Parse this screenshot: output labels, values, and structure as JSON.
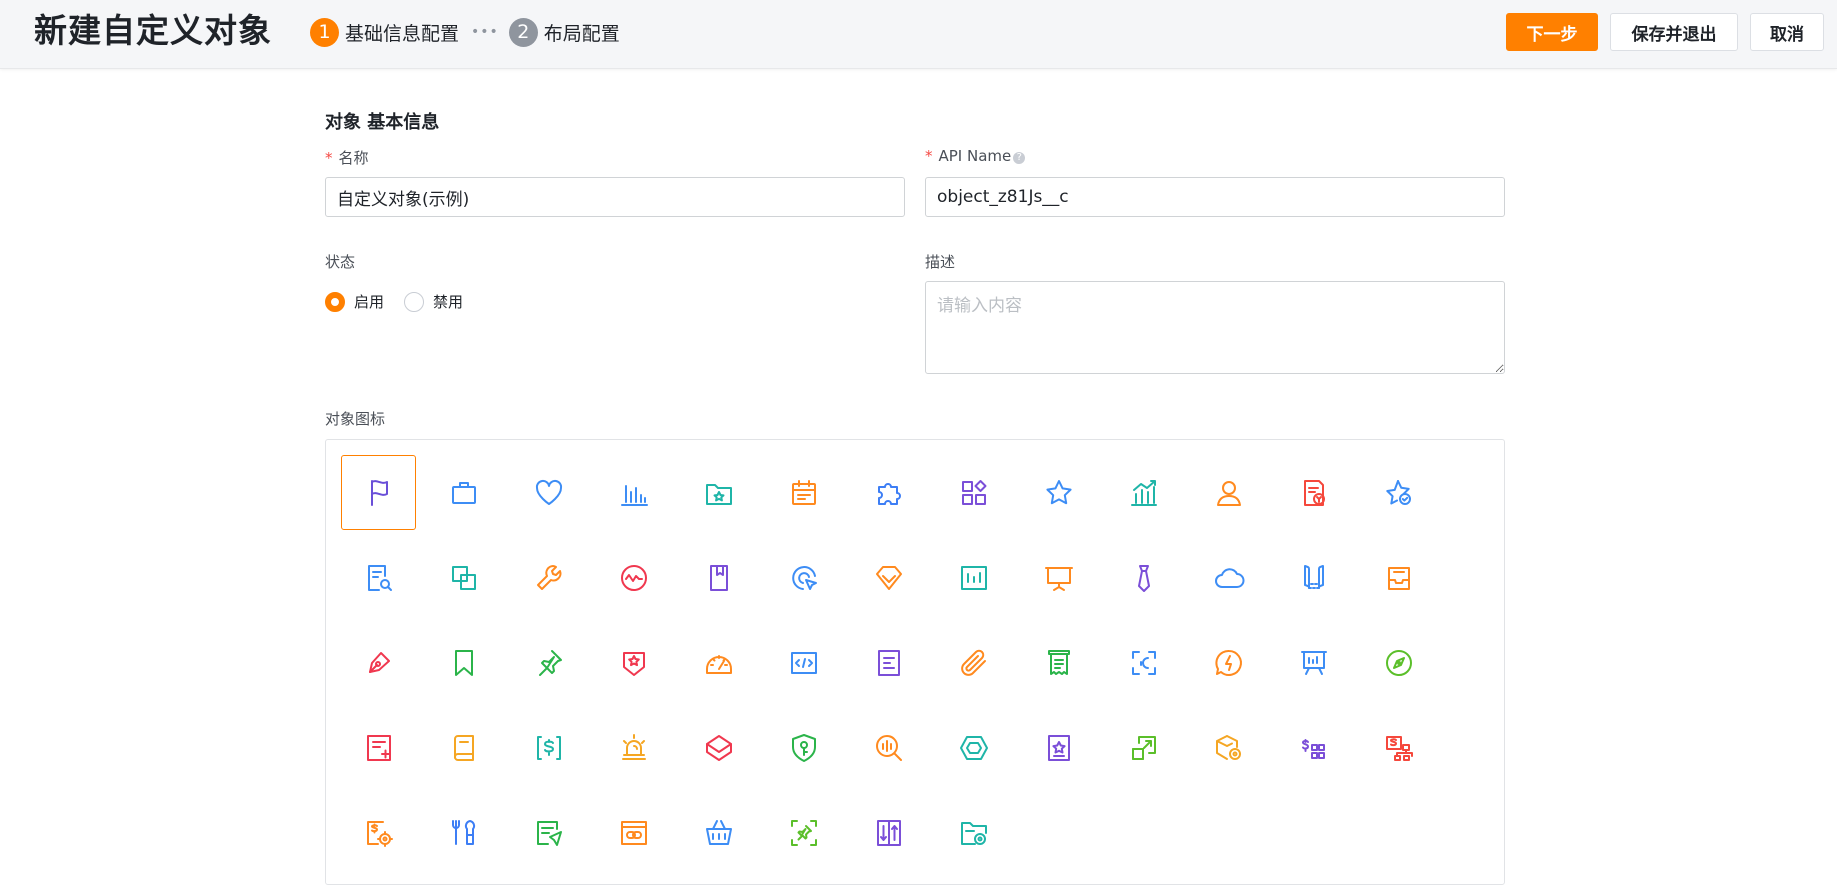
{
  "header": {
    "title": "新建自定义对象",
    "steps": [
      {
        "num": "1",
        "label": "基础信息配置"
      },
      {
        "num": "2",
        "label": "布局配置"
      }
    ],
    "step_separator": "•••",
    "buttons": {
      "next": "下一步",
      "save_exit": "保存并退出",
      "cancel": "取消"
    }
  },
  "form": {
    "section_title": "对象 基本信息",
    "name": {
      "label": "名称",
      "required_mark": "*",
      "value": "自定义对象(示例)"
    },
    "api_name": {
      "label": "API Name",
      "required_mark": "*",
      "help": "?",
      "value": "object_z81Js__c"
    },
    "status": {
      "label": "状态",
      "options": [
        {
          "label": "启用",
          "checked": true
        },
        {
          "label": "禁用",
          "checked": false
        }
      ]
    },
    "description": {
      "label": "描述",
      "placeholder": "请输入内容"
    },
    "icon_label": "对象图标"
  },
  "icons": [
    {
      "name": "flag",
      "color": "#6a4fd8",
      "selected": true
    },
    {
      "name": "briefcase",
      "color": "#3d8df5"
    },
    {
      "name": "heart",
      "color": "#3d8df5"
    },
    {
      "name": "bar-chart",
      "color": "#3d8df5"
    },
    {
      "name": "folder-star",
      "color": "#1fb5a8"
    },
    {
      "name": "calendar",
      "color": "#ff8a1f"
    },
    {
      "name": "puzzle",
      "color": "#3d7ef5"
    },
    {
      "name": "apps",
      "color": "#7b4fd8"
    },
    {
      "name": "star",
      "color": "#3d8df5"
    },
    {
      "name": "trend-chart",
      "color": "#1fb5a8"
    },
    {
      "name": "user",
      "color": "#ff8a1f"
    },
    {
      "name": "invoice",
      "color": "#f5483c"
    },
    {
      "name": "star-check",
      "color": "#3d8df5"
    },
    {
      "name": "doc-search",
      "color": "#3d8df5"
    },
    {
      "name": "copy",
      "color": "#1fb5a8"
    },
    {
      "name": "wrench",
      "color": "#ff8a1f"
    },
    {
      "name": "activity",
      "color": "#f0384f"
    },
    {
      "name": "bookmark-book",
      "color": "#7b4fd8"
    },
    {
      "name": "cursor-target",
      "color": "#3d8df5"
    },
    {
      "name": "diamond",
      "color": "#ff8a1f"
    },
    {
      "name": "chart-window",
      "color": "#1fb5a8"
    },
    {
      "name": "presentation",
      "color": "#ff8a1f"
    },
    {
      "name": "tie",
      "color": "#7b4fd8"
    },
    {
      "name": "cloud",
      "color": "#3d8df5"
    },
    {
      "name": "map-book",
      "color": "#3d8df5"
    },
    {
      "name": "inbox",
      "color": "#ff8a1f"
    },
    {
      "name": "pen",
      "color": "#f0384f"
    },
    {
      "name": "bookmark",
      "color": "#2bb44a"
    },
    {
      "name": "pin",
      "color": "#2bb44a"
    },
    {
      "name": "badge-star",
      "color": "#f0384f"
    },
    {
      "name": "gauge",
      "color": "#ff8a1f"
    },
    {
      "name": "code",
      "color": "#3d8df5"
    },
    {
      "name": "document",
      "color": "#7b4fd8"
    },
    {
      "name": "paperclip",
      "color": "#ff8a1f"
    },
    {
      "name": "receipt",
      "color": "#2bb44a"
    },
    {
      "name": "face-scan",
      "color": "#3d8df5"
    },
    {
      "name": "chat-flash",
      "color": "#ff8a1f"
    },
    {
      "name": "board",
      "color": "#3d8df5"
    },
    {
      "name": "compass",
      "color": "#5bbf2a"
    },
    {
      "name": "doc-plus",
      "color": "#f0384f"
    },
    {
      "name": "book",
      "color": "#f5a623"
    },
    {
      "name": "money-frame",
      "color": "#1fb5a8"
    },
    {
      "name": "alarm",
      "color": "#f5a623"
    },
    {
      "name": "layers",
      "color": "#f0384f"
    },
    {
      "name": "shield-key",
      "color": "#2bb44a"
    },
    {
      "name": "search-sound",
      "color": "#ff8a1f"
    },
    {
      "name": "hexagon",
      "color": "#1fb5a8"
    },
    {
      "name": "star-frame",
      "color": "#7b4fd8"
    },
    {
      "name": "resize",
      "color": "#5bbf2a"
    },
    {
      "name": "settings-cube",
      "color": "#f5a623"
    },
    {
      "name": "money-grid",
      "color": "#7b4fd8"
    },
    {
      "name": "money-org",
      "color": "#f5483c"
    },
    {
      "name": "money-gear",
      "color": "#ff8a1f"
    },
    {
      "name": "tools",
      "color": "#3d7ef5"
    },
    {
      "name": "doc-send",
      "color": "#2bb44a"
    },
    {
      "name": "link-box",
      "color": "#ff8a1f"
    },
    {
      "name": "basket",
      "color": "#3d8df5"
    },
    {
      "name": "pin-frame",
      "color": "#5bbf2a"
    },
    {
      "name": "columns",
      "color": "#7b4fd8"
    },
    {
      "name": "folder-gear",
      "color": "#1fb5a8"
    }
  ]
}
